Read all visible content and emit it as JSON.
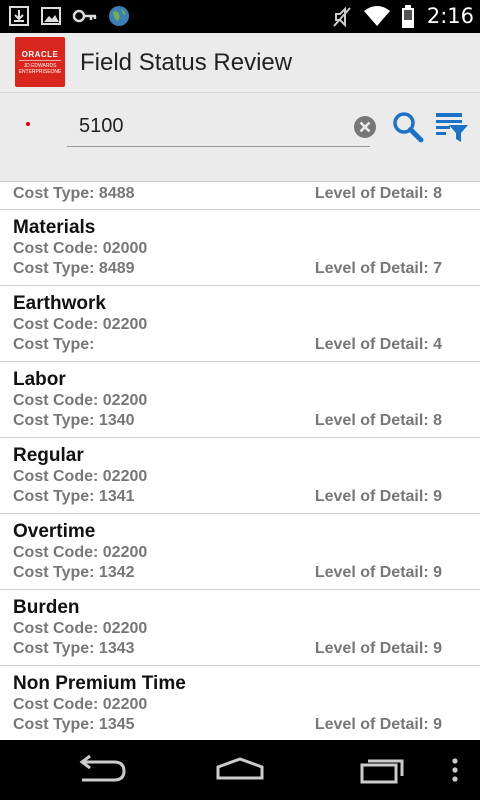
{
  "status_bar": {
    "time": "2:16",
    "left_icons": [
      "download-icon",
      "image-icon",
      "key-icon",
      "globe-icon"
    ],
    "right_icons": [
      "mute-icon",
      "wifi-icon",
      "battery-icon"
    ]
  },
  "app_bar": {
    "logo_text_top": "ORACLE",
    "logo_text_bottom": "JD EDWARDS ENTERPRISEONE",
    "title": "Field Status Review"
  },
  "search": {
    "value": "5100",
    "required": true,
    "clear_icon": "clear-icon",
    "search_icon": "search-icon",
    "filter_icon": "filter-icon"
  },
  "list": {
    "partial_row": {
      "cost_type": "Cost Type: 8488",
      "level_of_detail": "Level of Detail: 8"
    },
    "rows": [
      {
        "title": "Materials",
        "cost_code": "Cost Code: 02000",
        "cost_type": "Cost Type: 8489",
        "level_of_detail": "Level of Detail: 7"
      },
      {
        "title": "Earthwork",
        "cost_code": "Cost Code: 02200",
        "cost_type": "Cost Type:",
        "level_of_detail": "Level of Detail: 4"
      },
      {
        "title": "Labor",
        "cost_code": "Cost Code: 02200",
        "cost_type": "Cost Type: 1340",
        "level_of_detail": "Level of Detail: 8"
      },
      {
        "title": "Regular",
        "cost_code": "Cost Code: 02200",
        "cost_type": "Cost Type: 1341",
        "level_of_detail": "Level of Detail: 9"
      },
      {
        "title": "Overtime",
        "cost_code": "Cost Code: 02200",
        "cost_type": "Cost Type: 1342",
        "level_of_detail": "Level of Detail: 9"
      },
      {
        "title": "Burden",
        "cost_code": "Cost Code: 02200",
        "cost_type": "Cost Type: 1343",
        "level_of_detail": "Level of Detail: 9"
      },
      {
        "title": "Non Premium Time",
        "cost_code": "Cost Code: 02200",
        "cost_type": "Cost Type: 1345",
        "level_of_detail": "Level of Detail: 9"
      }
    ]
  },
  "nav_bar": {
    "icons": [
      "back-icon",
      "home-icon",
      "recent-apps-icon",
      "overflow-menu-icon"
    ]
  },
  "colors": {
    "accent_blue": "#1a73c8",
    "logo_red": "#d9261c",
    "required_red": "#e00000",
    "secondary_text": "#777777"
  }
}
